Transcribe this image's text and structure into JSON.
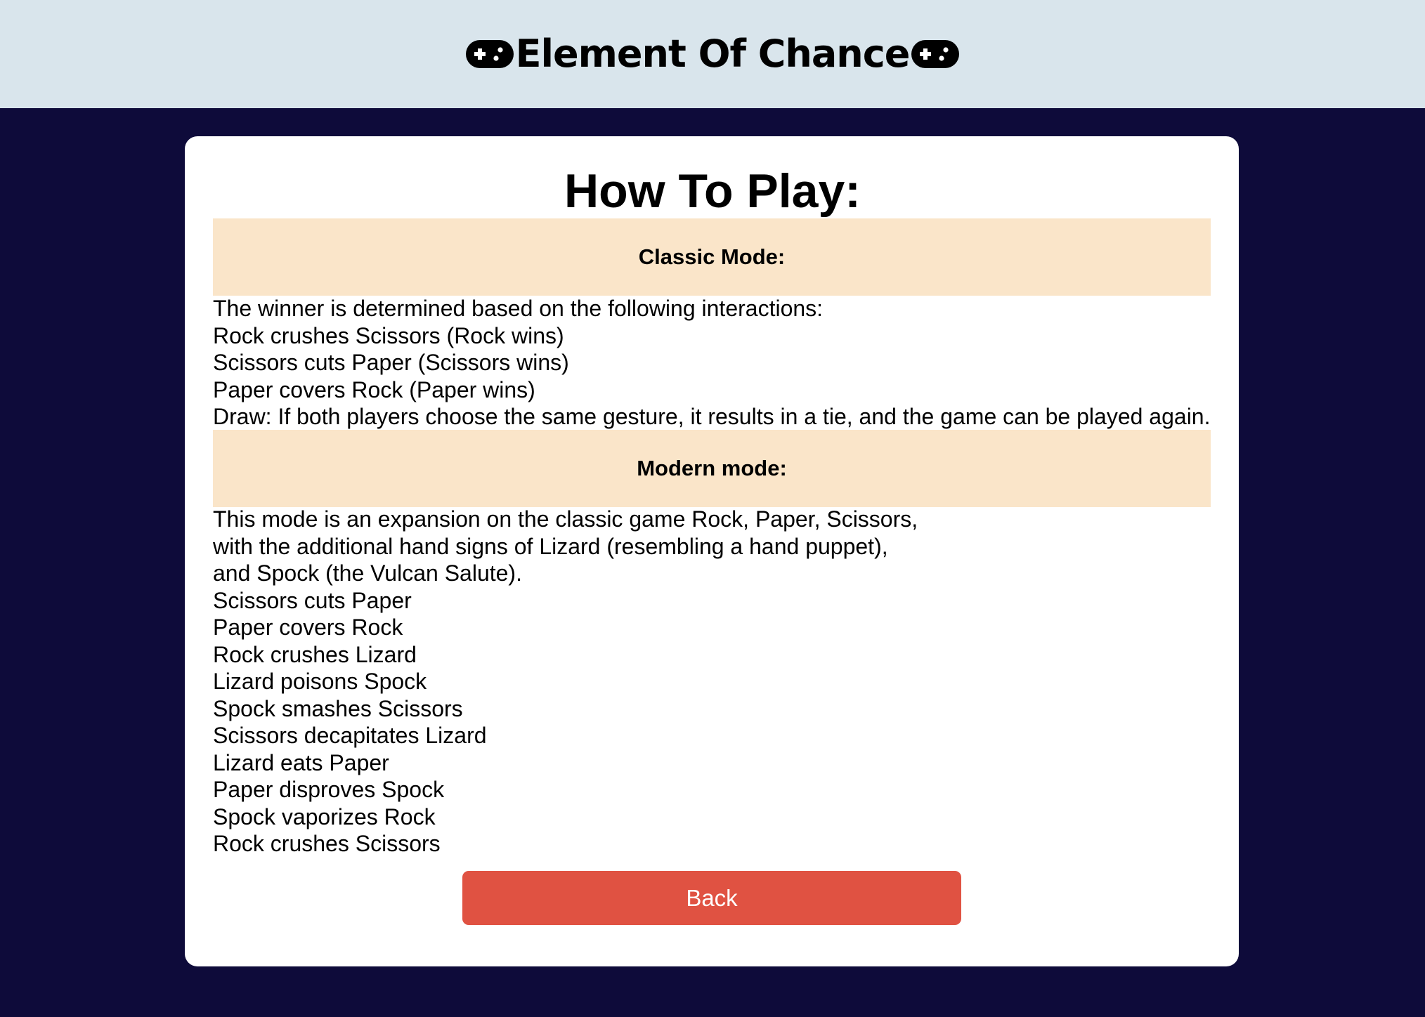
{
  "header": {
    "title": "Element Of Chance",
    "left_icon": "gamepad-icon",
    "right_icon": "gamepad-icon"
  },
  "card": {
    "title": "How To Play:",
    "classic": {
      "heading": "Classic Mode:",
      "lines": [
        "The winner is determined based on the following interactions:",
        "Rock crushes Scissors (Rock wins)",
        "Scissors cuts Paper (Scissors wins)",
        "Paper covers Rock (Paper wins)",
        "Draw: If both players choose the same gesture, it results in a tie, and the game can be played again."
      ]
    },
    "modern": {
      "heading": "Modern mode:",
      "lines": [
        "This mode is an expansion on the classic game Rock, Paper, Scissors,",
        "with the additional hand signs of Lizard (resembling a hand puppet),",
        "and Spock (the Vulcan Salute).",
        "Scissors cuts Paper",
        "Paper covers Rock",
        "Rock crushes Lizard",
        "Lizard poisons Spock",
        "Spock smashes Scissors",
        "Scissors decapitates Lizard",
        "Lizard eats Paper",
        "Paper disproves Spock",
        "Spock vaporizes Rock",
        "Rock crushes Scissors"
      ]
    },
    "back_label": "Back"
  },
  "colors": {
    "page_background": "#0e0b3a",
    "header_background": "#d9e5ec",
    "card_background": "#ffffff",
    "banner_background": "#fae5c9",
    "back_button": "#e05242"
  }
}
